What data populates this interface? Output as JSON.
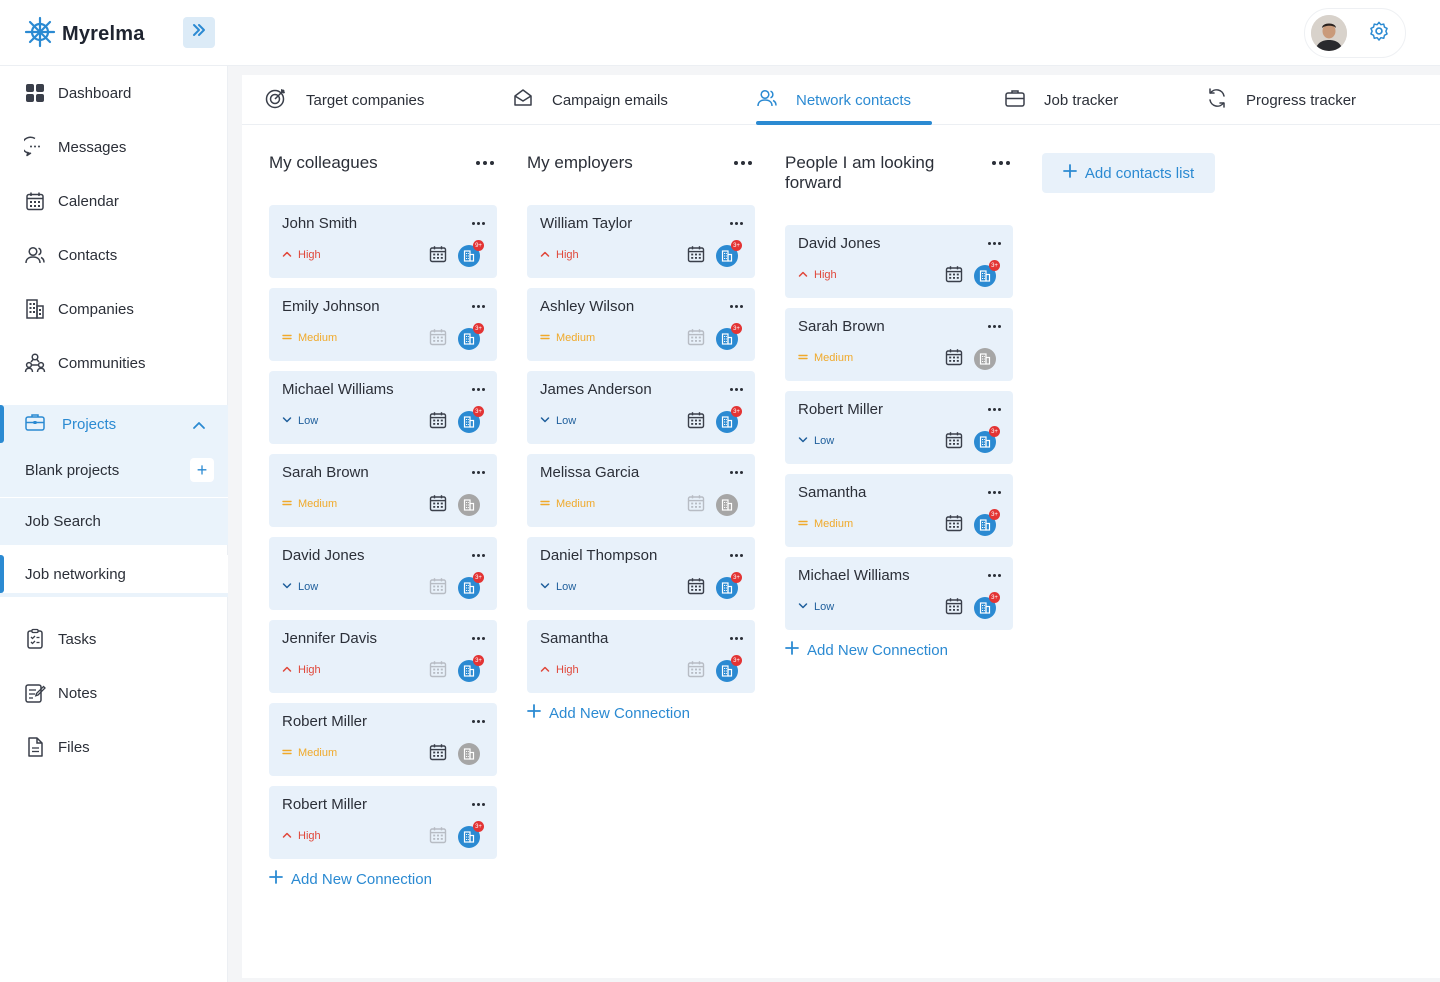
{
  "app": {
    "name": "Myrelma"
  },
  "colors": {
    "accent": "#2b8ad2",
    "high": "#e0473a",
    "medium": "#f0a92a",
    "low": "#1f5f9c",
    "card": "#e8f1fa"
  },
  "sidebar": {
    "items": [
      {
        "label": "Dashboard",
        "icon": "dashboard-icon"
      },
      {
        "label": "Messages",
        "icon": "chat-icon"
      },
      {
        "label": "Calendar",
        "icon": "calendar-icon"
      },
      {
        "label": "Contacts",
        "icon": "contacts-icon"
      },
      {
        "label": "Companies",
        "icon": "building-icon"
      },
      {
        "label": "Communities",
        "icon": "community-icon"
      }
    ],
    "projects": {
      "label": "Projects",
      "icon": "briefcase-icon"
    },
    "sub_items": [
      {
        "label": "Blank projects"
      },
      {
        "label": "Job Search"
      },
      {
        "label": "Job networking"
      }
    ],
    "bottom_items": [
      {
        "label": "Tasks",
        "icon": "clipboard-icon"
      },
      {
        "label": "Notes",
        "icon": "notes-icon"
      },
      {
        "label": "Files",
        "icon": "file-icon"
      }
    ]
  },
  "tabs": [
    {
      "label": "Target companies",
      "icon": "target-icon"
    },
    {
      "label": "Campaign emails",
      "icon": "mail-icon"
    },
    {
      "label": "Network contacts",
      "icon": "contacts-icon"
    },
    {
      "label": "Job tracker",
      "icon": "briefcase-icon"
    },
    {
      "label": "Progress tracker",
      "icon": "refresh-icon"
    }
  ],
  "add_contacts_list": "Add contacts list",
  "add_new_connection": "Add New Connection",
  "columns": [
    {
      "title": "My colleagues",
      "cards": [
        {
          "name": "John Smith",
          "priority": "High",
          "calendar_active": true,
          "company": "blue",
          "badge": "9+"
        },
        {
          "name": "Emily Johnson",
          "priority": "Medium",
          "calendar_active": false,
          "company": "blue",
          "badge": "3+"
        },
        {
          "name": "Michael Williams",
          "priority": "Low",
          "calendar_active": true,
          "company": "blue",
          "badge": "3+"
        },
        {
          "name": "Sarah Brown",
          "priority": "Medium",
          "calendar_active": true,
          "company": "grey",
          "badge": ""
        },
        {
          "name": "David Jones",
          "priority": "Low",
          "calendar_active": false,
          "company": "blue",
          "badge": "3+"
        },
        {
          "name": "Jennifer Davis",
          "priority": "High",
          "calendar_active": false,
          "company": "blue",
          "badge": "3+"
        },
        {
          "name": "Robert Miller",
          "priority": "Medium",
          "calendar_active": true,
          "company": "grey",
          "badge": ""
        },
        {
          "name": "Robert Miller",
          "priority": "High",
          "calendar_active": false,
          "company": "blue",
          "badge": "3+"
        }
      ]
    },
    {
      "title": "My employers",
      "cards": [
        {
          "name": "William Taylor",
          "priority": "High",
          "calendar_active": true,
          "company": "blue",
          "badge": "3+"
        },
        {
          "name": "Ashley Wilson",
          "priority": "Medium",
          "calendar_active": false,
          "company": "blue",
          "badge": "3+"
        },
        {
          "name": "James Anderson",
          "priority": "Low",
          "calendar_active": true,
          "company": "blue",
          "badge": "3+"
        },
        {
          "name": "Melissa Garcia",
          "priority": "Medium",
          "calendar_active": false,
          "company": "grey",
          "badge": ""
        },
        {
          "name": "Daniel Thompson",
          "priority": "Low",
          "calendar_active": true,
          "company": "blue",
          "badge": "3+"
        },
        {
          "name": "Samantha",
          "priority": "High",
          "calendar_active": false,
          "company": "blue",
          "badge": "3+"
        }
      ]
    },
    {
      "title": "People I am looking forward",
      "cards": [
        {
          "name": "David Jones",
          "priority": "High",
          "calendar_active": true,
          "company": "blue",
          "badge": "3+"
        },
        {
          "name": "Sarah Brown",
          "priority": "Medium",
          "calendar_active": true,
          "company": "grey",
          "badge": ""
        },
        {
          "name": "Robert Miller",
          "priority": "Low",
          "calendar_active": true,
          "company": "blue",
          "badge": "3+"
        },
        {
          "name": "Samantha",
          "priority": "Medium",
          "calendar_active": true,
          "company": "blue",
          "badge": "3+"
        },
        {
          "name": "Michael Williams",
          "priority": "Low",
          "calendar_active": true,
          "company": "blue",
          "badge": "3+"
        }
      ]
    }
  ]
}
